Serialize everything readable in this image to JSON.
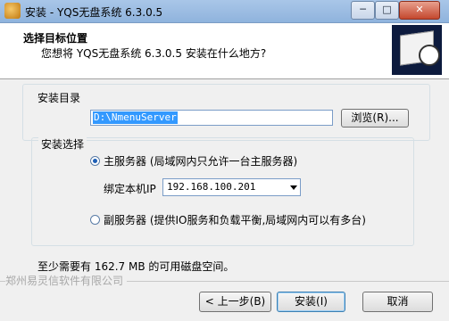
{
  "window": {
    "title": "安装 - YQS无盘系统 6.3.0.5",
    "minimize_glyph": "─",
    "maximize_glyph": "□",
    "close_glyph": "✕"
  },
  "header": {
    "title": "选择目标位置",
    "subtitle": "您想将 YQS无盘系统 6.3.0.5 安装在什么地方?",
    "image_icon": "server-install-icon"
  },
  "install_dir": {
    "group_label": "安装目录",
    "path_value": "D:\\NmenuServer",
    "browse_label": "浏览(R)..."
  },
  "install_type": {
    "group_label": "安装选择",
    "main_server_label": "主服务器 (局域网内只允许一台主服务器)",
    "main_server_selected": true,
    "bind_ip_label": "绑定本机IP",
    "bind_ip_value": "192.168.100.201",
    "sub_server_label": "副服务器 (提供IO服务和负载平衡,局域网内可以有多台)",
    "sub_server_selected": false
  },
  "disk_space_text": "至少需要有 162.7 MB 的可用磁盘空间。",
  "brand_text": "郑州易灵信软件有限公司",
  "buttons": {
    "back": "< 上一步(B)",
    "install": "安装(I)",
    "cancel": "取消"
  }
}
